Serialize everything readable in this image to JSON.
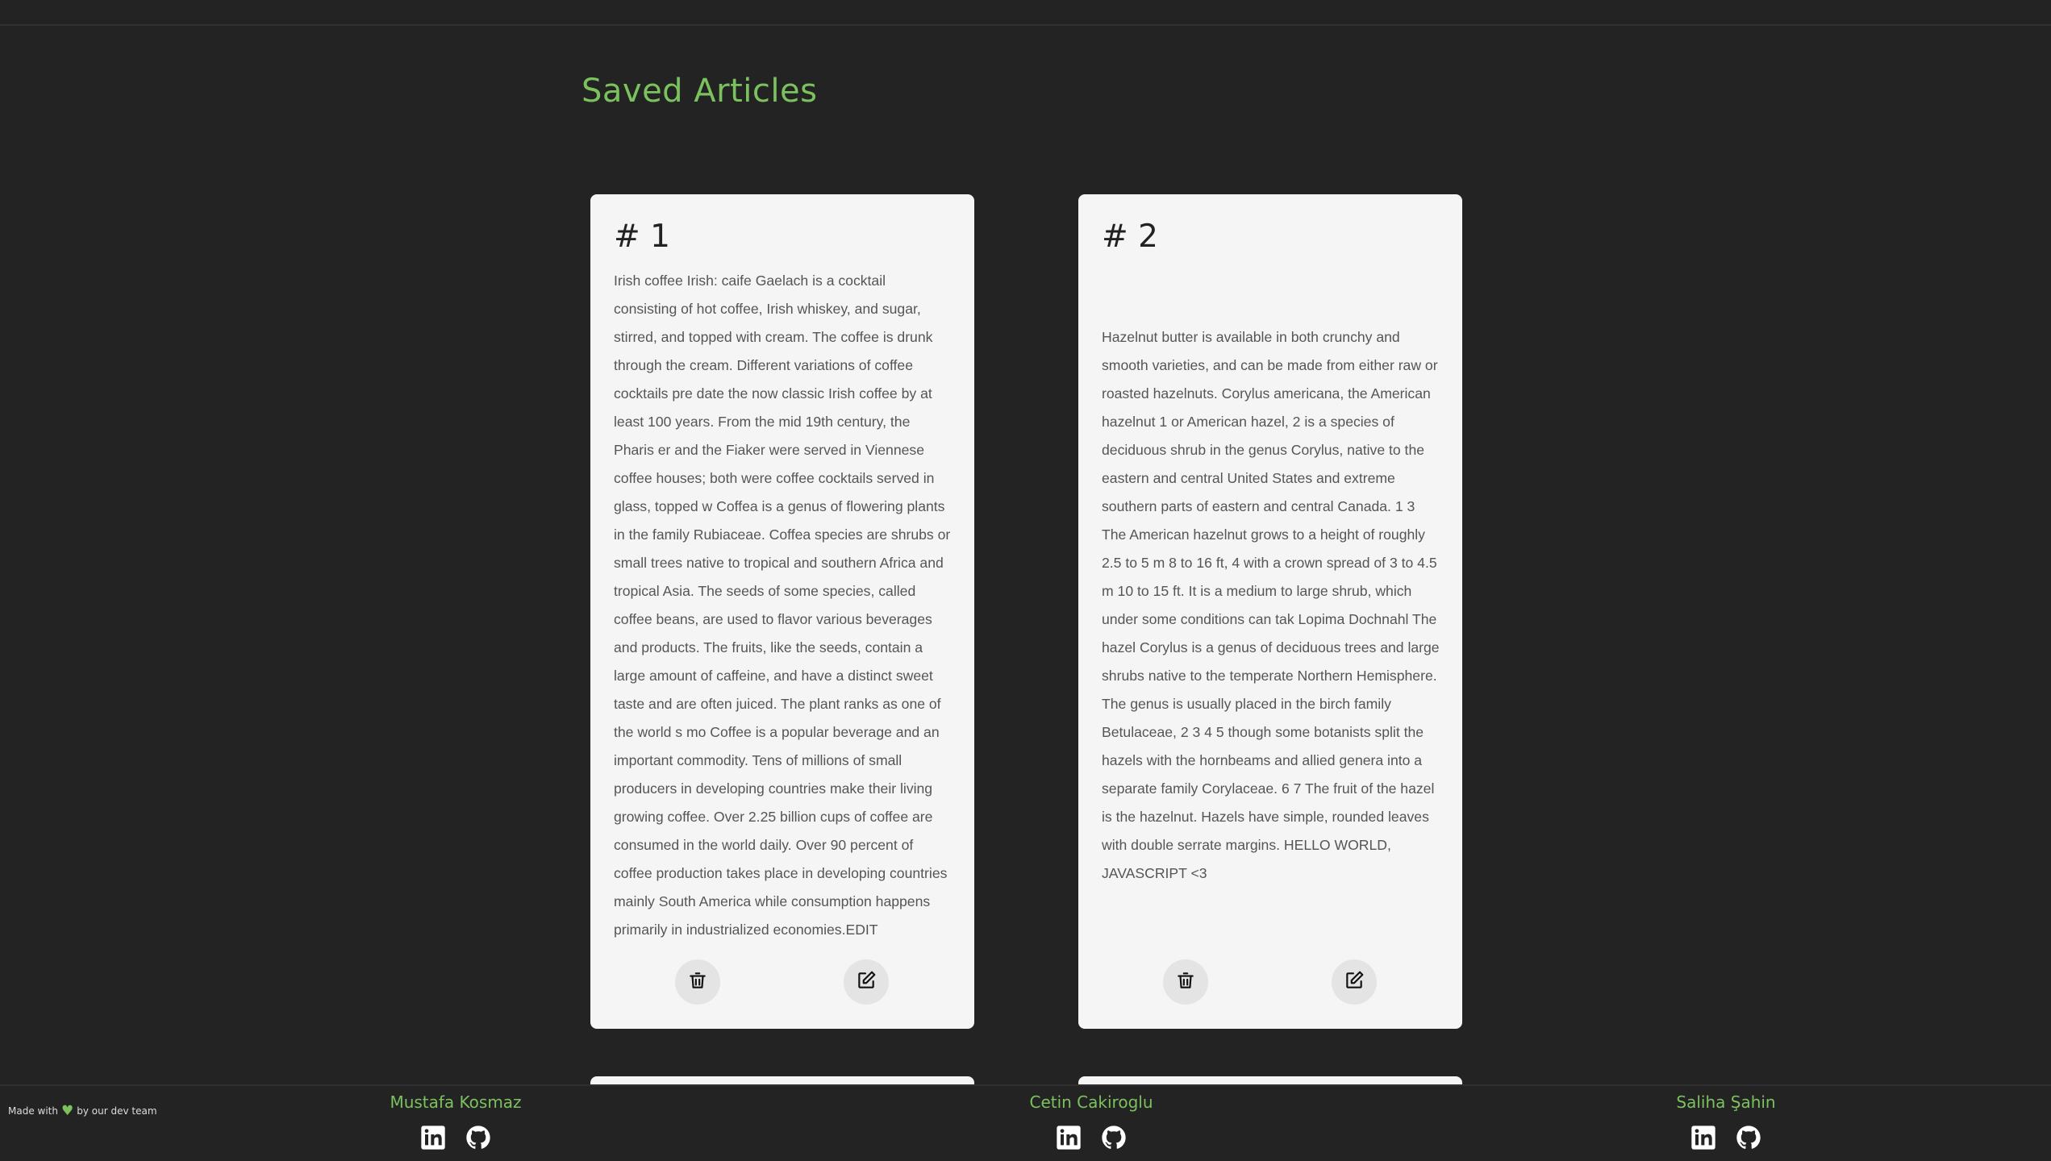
{
  "page": {
    "title": "Saved Articles"
  },
  "articles": [
    {
      "number": "# 1",
      "text": "Irish coffee Irish: caife Gaelach is a cocktail consisting of hot coffee, Irish whiskey, and sugar, stirred, and topped with cream. The coffee is drunk through the cream. Different variations of coffee cocktails pre date the now classic Irish coffee by at least 100 years. From the mid 19th century, the Pharis er and the Fiaker were served in Viennese coffee houses; both were coffee cocktails served in glass, topped w Coffea is a genus of flowering plants in the family Rubiaceae. Coffea species are shrubs or small trees native to tropical and southern Africa and tropical Asia. The seeds of some species, called coffee beans, are used to flavor various beverages and products. The fruits, like the seeds, contain a large amount of caffeine, and have a distinct sweet taste and are often juiced. The plant ranks as one of the world s mo Coffee is a popular beverage and an important commodity. Tens of millions of small producers in developing countries make their living growing coffee. Over 2.25 billion cups of coffee are consumed in the world daily. Over 90 percent of coffee production takes place in developing countries mainly South America while consumption happens primarily in industrialized economies.EDIT"
    },
    {
      "number": "# 2",
      "text": "Hazelnut butter is available in both crunchy and smooth varieties, and can be made from either raw or roasted hazelnuts. Corylus americana, the American hazelnut 1 or American hazel, 2 is a species of deciduous shrub in the genus Corylus, native to the eastern and central United States and extreme southern parts of eastern and central Canada. 1 3 The American hazelnut grows to a height of roughly 2.5 to 5 m 8 to 16 ft, 4 with a crown spread of 3 to 4.5 m 10 to 15 ft. It is a medium to large shrub, which under some conditions can tak Lopima Dochnahl The hazel Corylus is a genus of deciduous trees and large shrubs native to the temperate Northern Hemisphere. The genus is usually placed in the birch family Betulaceae, 2 3 4 5 though some botanists split the hazels with the hornbeams and allied genera into a separate family Corylaceae. 6 7 The fruit of the hazel is the hazelnut. Hazels have simple, rounded leaves with double serrate margins. HELLO WORLD, JAVASCRIPT <3"
    }
  ],
  "icons": {
    "delete": "trash-icon",
    "edit": "edit-icon",
    "linkedin": "linkedin-icon",
    "github": "github-icon",
    "heart": "heart-icon"
  },
  "footer": {
    "made_with_prefix": "Made with",
    "made_with_suffix": "by our dev team",
    "members": [
      {
        "name": "Mustafa Kosmaz"
      },
      {
        "name": "Cetin Cakiroglu"
      },
      {
        "name": "Saliha Şahin"
      }
    ]
  },
  "colors": {
    "accent": "#7bc25e",
    "background": "#232323",
    "card": "#f5f5f5"
  }
}
